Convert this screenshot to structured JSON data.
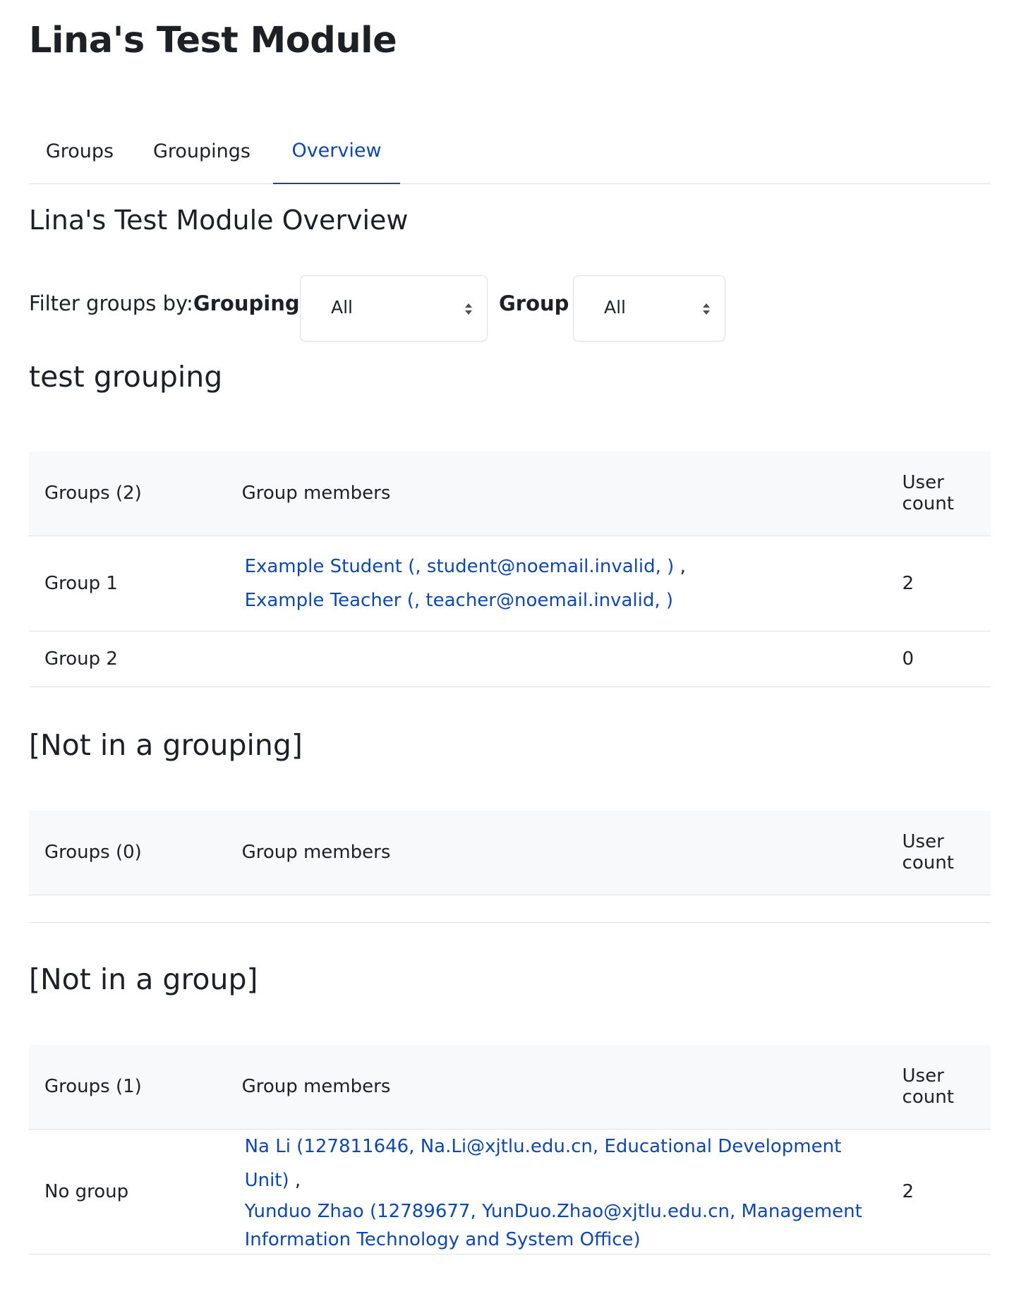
{
  "page": {
    "title": "Lina's Test Module"
  },
  "tabs": [
    {
      "label": "Groups"
    },
    {
      "label": "Groupings"
    },
    {
      "label": "Overview"
    }
  ],
  "overview": {
    "title": "Lina's Test Module Overview"
  },
  "filter": {
    "prefix": "Filter groups by:",
    "grouping_label": "Grouping",
    "grouping_value": "All",
    "group_label": "Group",
    "group_value": "All"
  },
  "columns": {
    "members": "Group members",
    "count_line1": "User",
    "count_line2": "count"
  },
  "sections": [
    {
      "title": "test grouping",
      "groups_header": "Groups (2)",
      "rows": [
        {
          "name": "Group 1",
          "members": [
            "Example Student (, student@noemail.invalid, )",
            "Example Teacher (, teacher@noemail.invalid, )"
          ],
          "count": "2"
        },
        {
          "name": "Group 2",
          "members": [],
          "count": "0"
        }
      ]
    },
    {
      "title": "[Not in a grouping]",
      "groups_header": "Groups (0)",
      "rows": []
    },
    {
      "title": "[Not in a group]",
      "groups_header": "Groups (1)",
      "rows": [
        {
          "name": "No group",
          "members": [
            "Na Li (127811646, Na.Li@xjtlu.edu.cn, Educational Development Unit)",
            "Yunduo Zhao (12789677, YunDuo.Zhao@xjtlu.edu.cn, Management Information Technology and System Office)"
          ],
          "count": "2"
        }
      ]
    }
  ],
  "colors": {
    "link": "#0f47ad",
    "header_bg": "#f8f9fa",
    "border": "#dee2e6",
    "text": "#1d2125"
  }
}
